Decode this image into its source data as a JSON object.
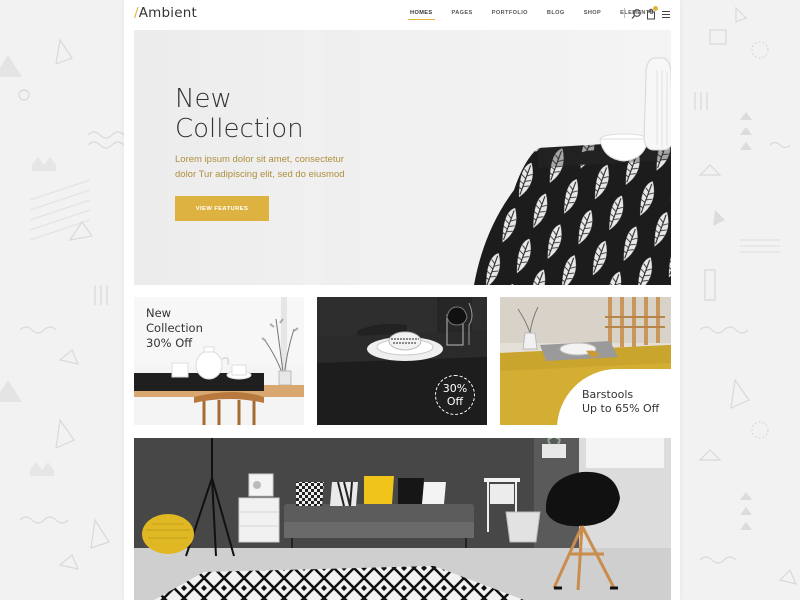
{
  "header": {
    "logo_slash": "/",
    "logo_text": "Ambient",
    "nav": [
      "HOMES",
      "PAGES",
      "PORTFOLIO",
      "BLOG",
      "SHOP",
      "ELEMENTS"
    ],
    "icons": [
      "search-icon",
      "cart-icon",
      "menu-icon"
    ]
  },
  "hero": {
    "title_line1": "New",
    "title_line2": "Collection",
    "text_line1": "Lorem ipsum dolor sit amet, consectetur",
    "text_line2": "dolor Tur adipiscing elit, sed do eiusmod",
    "button_label": "VIEW FEATURES"
  },
  "promos": {
    "first": {
      "line1": "New",
      "line2": "Collection",
      "line3": "30% Off"
    },
    "second": {
      "line1": "30%",
      "line2": "Off"
    },
    "third": {
      "line1": "Barstools",
      "line2": "Up to 65% Off"
    }
  },
  "colors": {
    "accent": "#deb240",
    "text_dark": "#333333",
    "hero_text": "#b08f3e",
    "background": "#f2f2f2"
  }
}
